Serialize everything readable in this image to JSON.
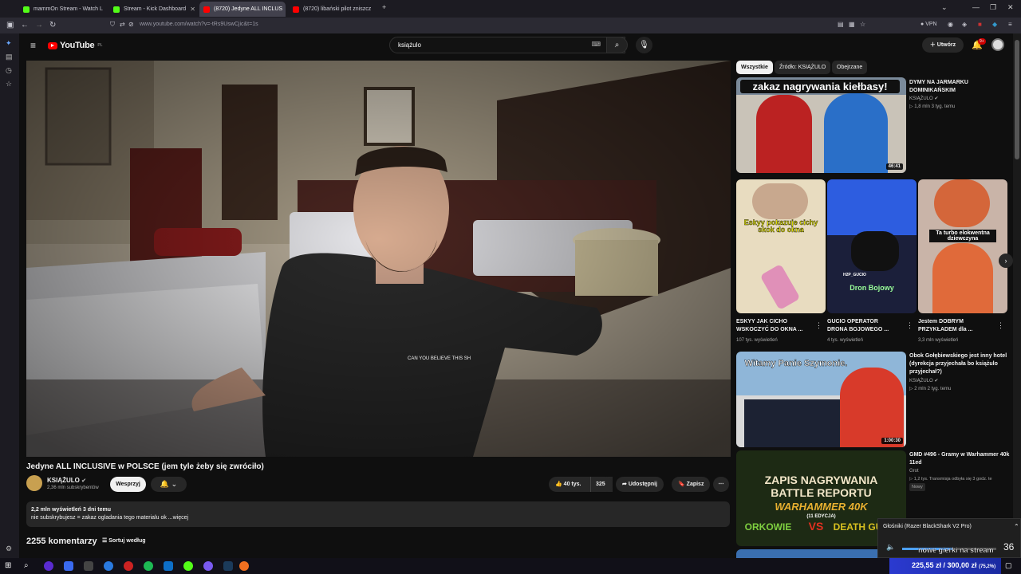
{
  "browser": {
    "tabs": [
      {
        "label": "mammOn Stream - Watch L",
        "color": "#53fc18"
      },
      {
        "label": "Stream - Kick Dashboard",
        "color": "#53fc18"
      },
      {
        "label": "(8720) Jedyne ALL INCLUS",
        "color": "#ff0000"
      },
      {
        "label": "(8720) libański pilot zniszcz",
        "color": "#ff0000"
      }
    ],
    "url": "www.youtube.com/watch?v=-tRs9UswCjic&t=1s",
    "vpn_label": "VPN"
  },
  "youtube": {
    "logo_text": "YouTube",
    "logo_region": "PL",
    "search_value": "książulo",
    "create_label": "Utwórz",
    "notifications_badge": "9+"
  },
  "video": {
    "title": "Jedyne ALL INCLUSIVE w POLSCE (jem tyle żeby się zwróciło)",
    "channel": "KSIĄŻULO",
    "subscribers": "2,36 mln subskrybentów",
    "support_label": "Wesprzyj",
    "likes": "40 tys.",
    "dislikes": "325",
    "share_label": "Udostępnij",
    "save_label": "Zapisz",
    "views_line": "2,2 mln wyświetleń  3 dni temu",
    "desc_line": "nie subskrybujesz = zakaz ogladania tego materialu ok ...więcej",
    "comments_count": "2255 komentarzy",
    "sort_label": "Sortuj według",
    "shirt_text": "CAN YOU BELIEVE THIS SH"
  },
  "chips": [
    "Wszystkie",
    "Źródło: KSIĄŻULO",
    "Obejrzane"
  ],
  "recs": [
    {
      "title1": "DYMY NA JARMARKU",
      "title2": "DOMINIKAŃSKIM",
      "channel": "KSIĄŻULO",
      "meta": "▷ 1,8 mln  3 tyg. temu",
      "duration": "46:41",
      "overlay": "zakaz nagrywania kiełbasy!"
    },
    {
      "title1": "Obok Gołębiewskiego jest inny hotel",
      "title2": "(dyrekcja przyjechała bo książulo",
      "title3": "przyjechał?)",
      "channel": "KSIĄŻULO",
      "meta": "▷ 2 mln  2 tyg. temu",
      "duration": "1:00:30",
      "overlay": "Witamy Panie Szymonie."
    },
    {
      "title1": "GMD #496 - Gramy w Warhammer 40k",
      "title2": "11ed",
      "channel": "Grot",
      "meta": "▷ 1,2 tys.   Transmisja odbyła się 3 godz. te",
      "badge": "Nowy",
      "overlay1": "ZAPIS NAGRYWANIA",
      "overlay2": "BATTLE REPORTU",
      "overlay3": "WARHAMMER 40K",
      "overlay4": "(11 EDYCJA)",
      "overlay5": "ORKOWIE",
      "overlay6": "VS",
      "overlay7": "DEATH GUARD"
    }
  ],
  "shorts": [
    {
      "title1": "ESKYY JAK CICHO",
      "title2": "WSKOCZYĆ DO OKNA ...",
      "views": "107 tys. wyświetleń",
      "overlay": "Eskyy pokazuje cichy skok do okna"
    },
    {
      "title1": "GUCIO OPERATOR",
      "title2": "DRONA BOJOWEGO ...",
      "views": "4 tys. wyświetleń",
      "overlay": "Dron Bojowy",
      "small": "H2P_GUCIO"
    },
    {
      "title1": "Jestem DOBRYM",
      "title2": "PRZYKŁADEM dla ...",
      "views": "3,3 mln wyświetleń",
      "overlay": "Ta turbo elokwentna dziewczyna"
    }
  ],
  "popup": {
    "device": "Głośniki (Razer BlackShark V2 Pro)",
    "caption": "nowe gierki na stream",
    "volume": "36"
  },
  "taskbar": {
    "balance": "225,55 zł / 300,00 zł",
    "extra": "(75,2%)"
  }
}
